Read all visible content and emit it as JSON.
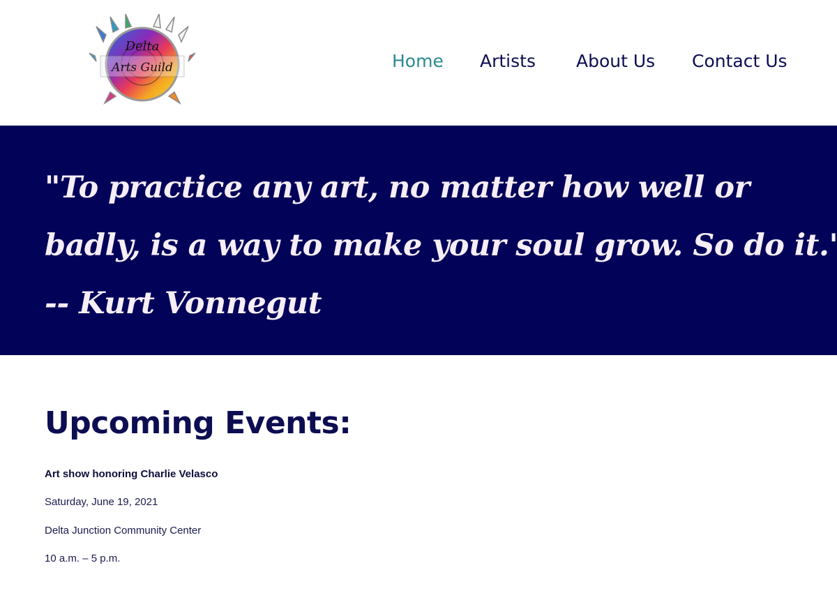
{
  "logo": {
    "text_line1": "Delta",
    "text_line2": "Arts Guild"
  },
  "nav": {
    "items": [
      {
        "label": "Home",
        "active": true
      },
      {
        "label": "Artists",
        "active": false
      },
      {
        "label": "About Us",
        "active": false
      },
      {
        "label": "Contact Us",
        "active": false
      }
    ]
  },
  "quote": {
    "line1": "\"To practice any art, no matter how well or",
    "line2": "badly, is a way to make your soul grow. So do it.\"",
    "attribution": "-- Kurt Vonnegut"
  },
  "events": {
    "title": "Upcoming Events:",
    "items": [
      {
        "name": "Art show honoring Charlie Velasco",
        "date": "Saturday, June 19, 2021",
        "location": "Delta Junction Community Center",
        "time": "10 a.m. – 5 p.m."
      }
    ]
  },
  "colors": {
    "navy": "#020259",
    "nav_text": "#0d0d52",
    "nav_active": "#2b8a8f",
    "quote_text": "#f6eef6"
  }
}
